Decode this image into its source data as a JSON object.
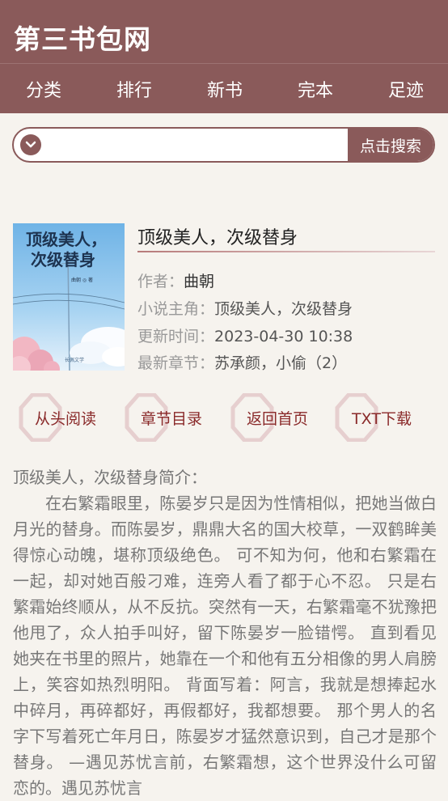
{
  "site": {
    "title": "第三书包网"
  },
  "nav": {
    "items": [
      "分类",
      "排行",
      "新书",
      "完本",
      "足迹"
    ]
  },
  "search": {
    "placeholder": "",
    "button_label": "点击搜索"
  },
  "book": {
    "title": "顶级美人，次级替身",
    "cover": {
      "title_text": "顶级美人，次级替身",
      "author_text": "曲朝 ◎ 著",
      "publisher": "长佩文学"
    },
    "author_label": "作者：",
    "author": "曲朝",
    "protagonist_label": "小说主角：",
    "protagonist": "顶级美人，次级替身",
    "updated_label": "更新时间：",
    "updated": "2023-04-30 10:38",
    "latest_label": "最新章节：",
    "latest": "苏承颜，小偷（2）"
  },
  "actions": [
    "从头阅读",
    "章节目录",
    "返回首页",
    "TXT下载"
  ],
  "intro": {
    "heading": "顶级美人，次级替身简介：",
    "text": "在右繁霜眼里，陈晏岁只是因为性情相似，把她当做白月光的替身。而陈晏岁，鼎鼎大名的国大校草，一双鹤眸美得惊心动魄，堪称顶级绝色。 可不知为何，他和右繁霜在一起，却对她百般刁难，连旁人看了都于心不忍。 只是右繁霜始终顺从，从不反抗。突然有一天，右繁霜毫不犹豫把他甩了，众人拍手叫好，留下陈晏岁一脸错愕。 直到看见她夹在书里的照片，她靠在一个和他有五分相像的男人肩膀上，笑容如热烈明阳。 背面写着：阿言，我就是想捧起水中碎月，再碎都好，再假都好，我都想要。 那个男人的名字下写着死亡年月日，陈晏岁才猛然意识到，自己才是那个替身。 —遇见苏忧言前，右繁霜想，这个世界没什么可留恋的。遇见苏忧言"
  },
  "colors": {
    "brand": "#8a5a5a",
    "background": "#f6f3ee",
    "action_text": "#8a2a2a"
  }
}
